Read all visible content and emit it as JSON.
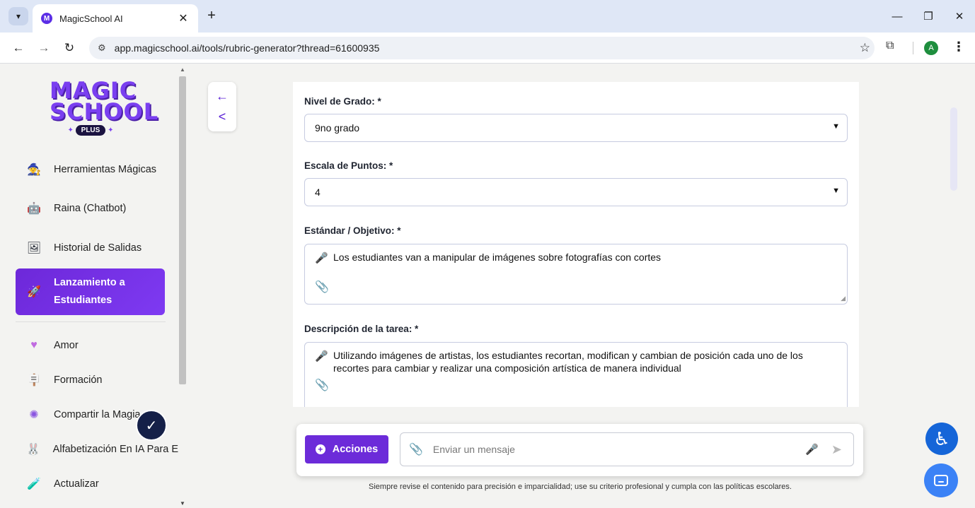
{
  "browser": {
    "tab_title": "MagicSchool AI",
    "tab_favicon_letter": "M",
    "url": "app.magicschool.ai/tools/rubric-generator?thread=61600935",
    "profile_initial": "A",
    "icons": [
      "tab-dropdown-icon",
      "close-icon",
      "plus-icon",
      "back-arrow-icon",
      "forward-arrow-icon",
      "reload-icon",
      "site-info-icon",
      "star-icon",
      "extensions-icon",
      "kebab-menu-icon",
      "minimize-icon",
      "restore-icon"
    ]
  },
  "logo": {
    "line1": "MAGIC",
    "line2": "SCHOOL",
    "badge": "PLUS"
  },
  "sidebar": {
    "items": [
      {
        "label": "Herramientas Mágicas",
        "icon": "wizard-icon"
      },
      {
        "label": "Raina (Chatbot)",
        "icon": "robot-icon"
      },
      {
        "label": "Historial de Salidas",
        "icon": "history-icon"
      },
      {
        "label": "Lanzamiento a Estudiantes",
        "icon": "rocket-icon"
      },
      {
        "label": "Amor",
        "icon": "heart-icon"
      },
      {
        "label": "Formación",
        "icon": "easel-icon"
      },
      {
        "label": "Compartir la Magia",
        "icon": "sparkle-icon"
      },
      {
        "label": "Alfabetización En IA Para E",
        "icon": "bunny-icon"
      },
      {
        "label": "Actualizar",
        "icon": "potion-icon"
      }
    ],
    "active_index": 3
  },
  "form": {
    "grade_label": "Nivel de Grado: *",
    "grade_value": "9no grado",
    "points_label": "Escala de Puntos: *",
    "points_value": "4",
    "standard_label": "Estándar / Objetivo: *",
    "standard_value": "Los estudiantes van a manipular de imágenes sobre fotografías con cortes",
    "task_label": "Descripción de la tarea: *",
    "task_value": "Utilizando imágenes de artistas, los estudiantes recortan, modifican y cambian de posición cada uno de los recortes para cambiar y realizar una composición artística de manera individual"
  },
  "composer": {
    "actions_label": "Acciones",
    "message_placeholder": "Enviar un mensaje",
    "disclaimer": "Siempre revise el contenido para precisión e imparcialidad; use su criterio profesional y cumpla con las políticas escolares."
  },
  "colors": {
    "accent": "#6c2bd9",
    "accessibility": "#1565d8",
    "chat": "#3b82f6"
  }
}
